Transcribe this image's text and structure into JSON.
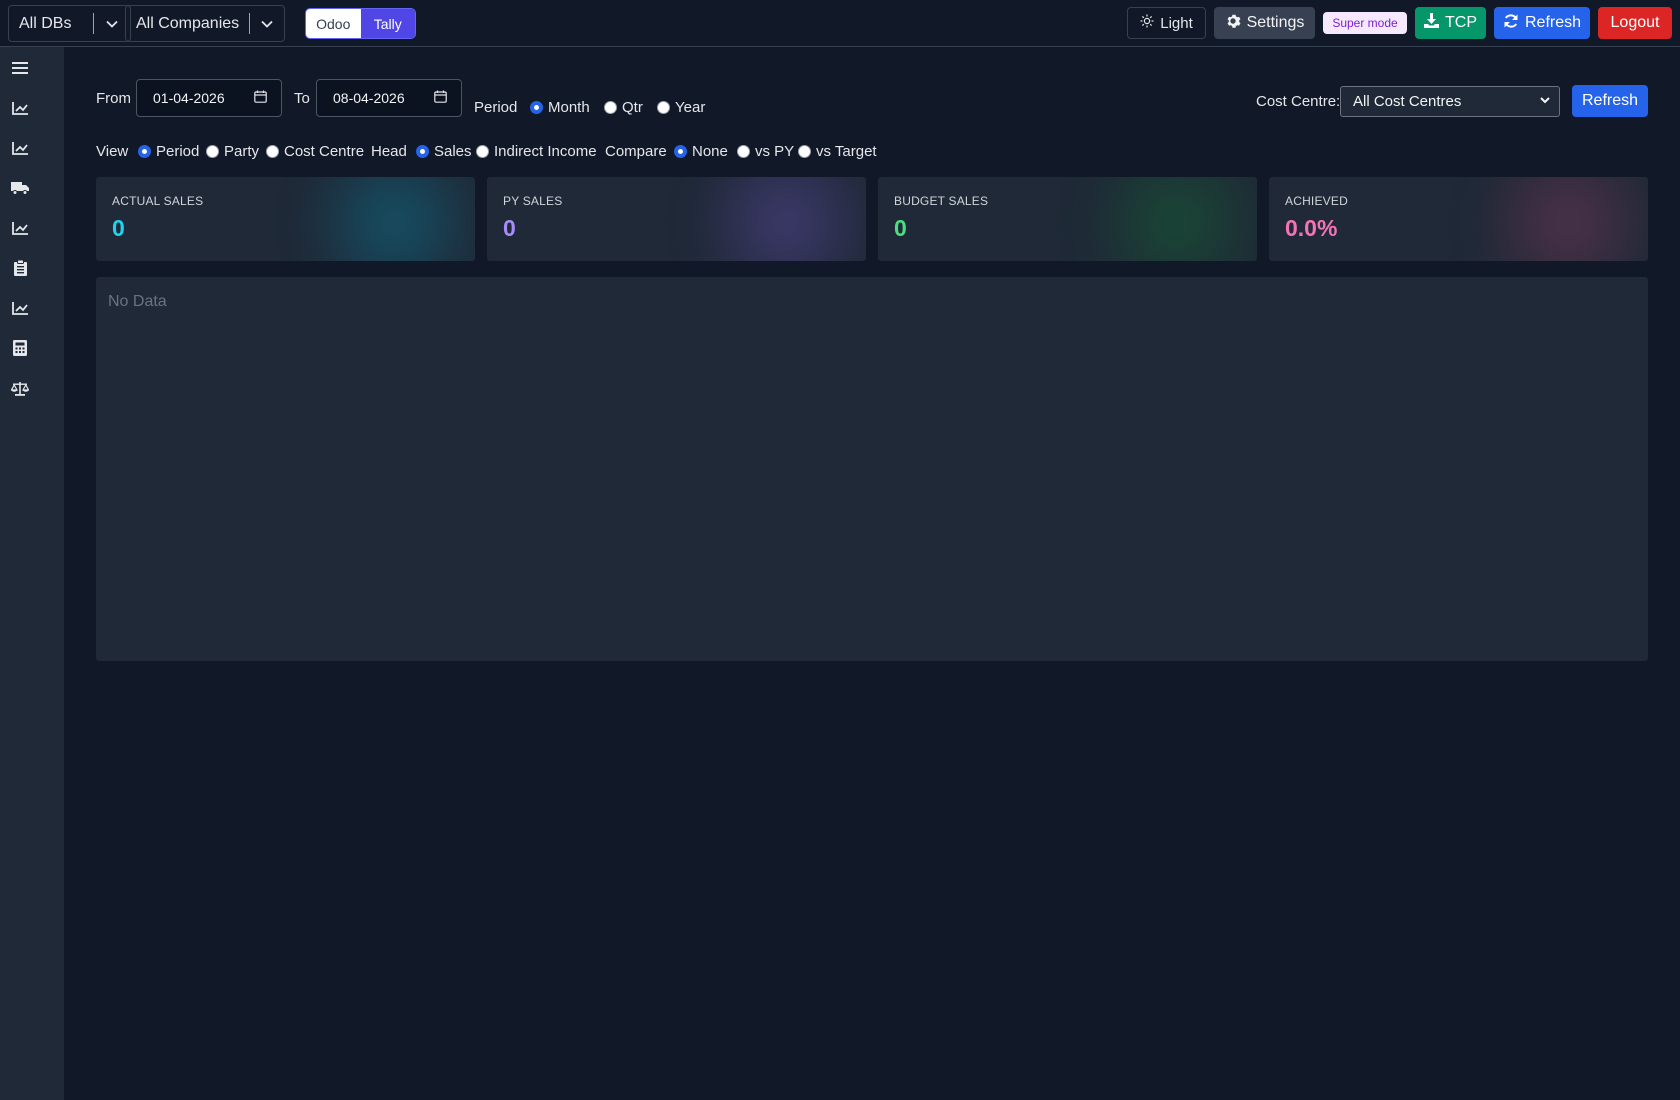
{
  "topbar": {
    "db_select": "All DBs",
    "company_select": "All Companies",
    "source_toggle": {
      "odoo": "Odoo",
      "tally": "Tally",
      "active": "Tally"
    },
    "light_label": "Light",
    "settings_label": "Settings",
    "super_mode_label": "Super mode",
    "tcp_label": "TCP",
    "refresh_label": "Refresh",
    "logout_label": "Logout"
  },
  "sidebar": {
    "icons": [
      "menu-icon",
      "line-chart-icon",
      "line-chart-icon",
      "truck-icon",
      "line-chart-icon",
      "clipboard-icon",
      "line-chart-icon",
      "calculator-icon",
      "scale-icon"
    ]
  },
  "filters": {
    "from_label": "From",
    "from_date": "01-04-2026",
    "to_label": "To",
    "to_date": "08-04-2026",
    "period_label": "Period",
    "period_options": [
      "Month",
      "Qtr",
      "Year"
    ],
    "period_selected": "Month",
    "cost_centre_label": "Cost Centre:",
    "cost_centre_value": "All Cost Centres",
    "refresh_label": "Refresh",
    "view_label": "View",
    "view_options": [
      "Period",
      "Party",
      "Cost Centre"
    ],
    "view_selected": "Period",
    "head_label": "Head",
    "head_options": [
      "Sales",
      "Indirect Income"
    ],
    "head_selected": "Sales",
    "compare_label": "Compare",
    "compare_options": [
      "None",
      "vs PY",
      "vs Target"
    ],
    "compare_selected": "None"
  },
  "cards": [
    {
      "title": "ACTUAL SALES",
      "value": "0",
      "color": "#22d3ee",
      "glow": "#0e7490"
    },
    {
      "title": "PY SALES",
      "value": "0",
      "color": "#a78bfa",
      "glow": "#5b4a9e"
    },
    {
      "title": "BUDGET SALES",
      "value": "0",
      "color": "#4ade80",
      "glow": "#166534"
    },
    {
      "title": "ACHIEVED",
      "value": "0.0%",
      "color": "#f472b6",
      "glow": "#7a3a5a"
    }
  ],
  "panel": {
    "empty_text": "No Data"
  },
  "colors": {
    "background": "#111827",
    "surface": "#1f2937",
    "accent": "#2563eb",
    "success": "#059669",
    "danger": "#dc2626"
  }
}
